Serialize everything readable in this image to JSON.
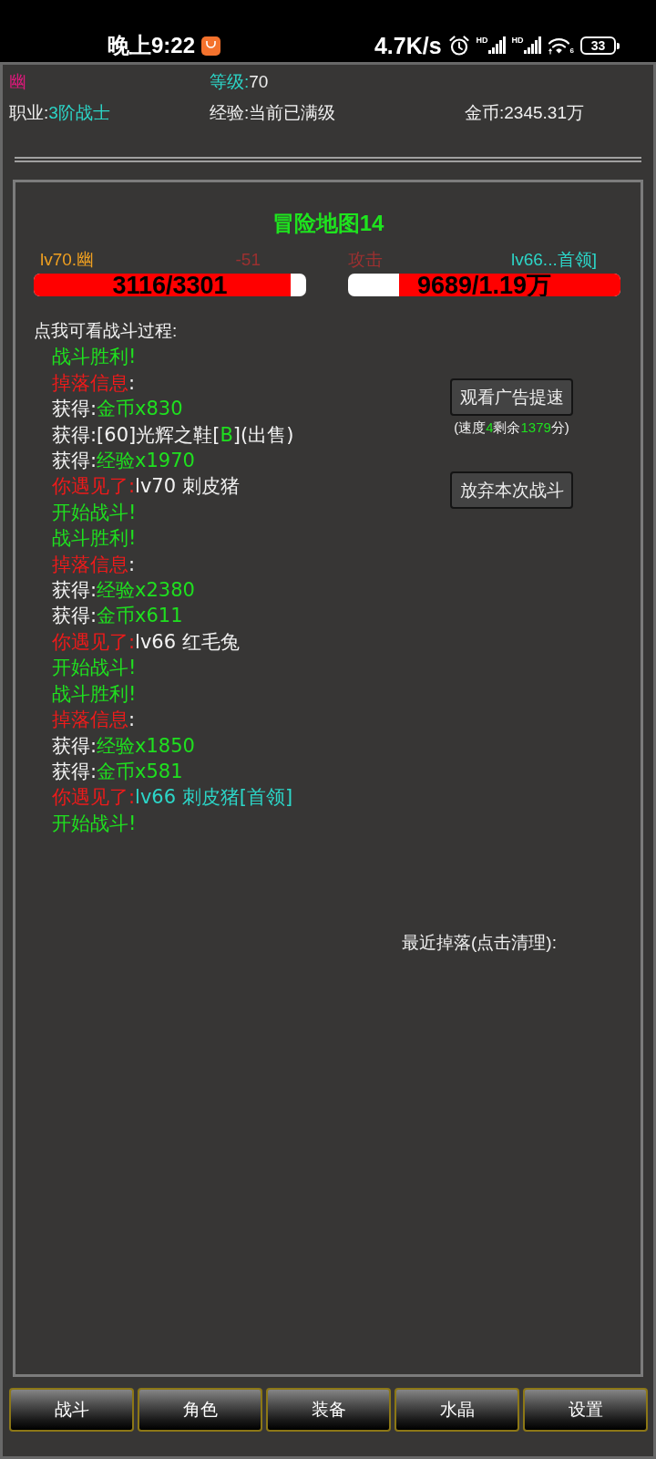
{
  "status_bar": {
    "time": "晚上9:22",
    "net_speed": "4.7K/s",
    "signals": [
      {
        "badge": "HD"
      },
      {
        "badge": "HD"
      }
    ],
    "wifi_badge": "6",
    "battery": "33"
  },
  "player": {
    "name": "幽",
    "level": {
      "label": "等级:",
      "value": "70"
    },
    "class": {
      "label": "职业:",
      "value": "3阶战士"
    },
    "exp": {
      "label": "经验:",
      "value": "当前已满级"
    },
    "gold": {
      "label": "金币:",
      "value": "2345.31万"
    }
  },
  "battle": {
    "title": "冒险地图14",
    "player": {
      "name": "lv70.幽",
      "damage": "-51",
      "hp": "3116/3301",
      "level": 0.944
    },
    "enemy": {
      "action": "攻击",
      "name": "lv66...首领]",
      "hp": "9689/1.19万",
      "level": 0.814
    }
  },
  "log": {
    "header": "点我可看战斗过程:",
    "lines": [
      {
        "segments": [
          {
            "text": "战斗胜利!",
            "kind": "good"
          }
        ]
      },
      {
        "segments": [
          {
            "text": "掉落信息",
            "kind": "alert"
          },
          {
            "text": ":",
            "kind": "plain"
          }
        ]
      },
      {
        "segments": [
          {
            "text": "获得:",
            "kind": "plain"
          },
          {
            "text": "金币x830",
            "kind": "good"
          }
        ]
      },
      {
        "segments": [
          {
            "text": "获得:[60]光辉之鞋[",
            "kind": "plain"
          },
          {
            "text": "B",
            "kind": "good"
          },
          {
            "text": "](出售)",
            "kind": "plain"
          }
        ]
      },
      {
        "segments": [
          {
            "text": "获得:",
            "kind": "plain"
          },
          {
            "text": "经验x1970",
            "kind": "good"
          }
        ]
      },
      {
        "segments": [
          {
            "text": "你遇见了:",
            "kind": "alert"
          },
          {
            "text": "lv70 刺皮猪",
            "kind": "plain"
          }
        ]
      },
      {
        "segments": [
          {
            "text": "开始战斗!",
            "kind": "good"
          }
        ]
      },
      {
        "segments": [
          {
            "text": "战斗胜利!",
            "kind": "good"
          }
        ]
      },
      {
        "segments": [
          {
            "text": "掉落信息",
            "kind": "alert"
          },
          {
            "text": ":",
            "kind": "plain"
          }
        ]
      },
      {
        "segments": [
          {
            "text": "获得:",
            "kind": "plain"
          },
          {
            "text": "经验x2380",
            "kind": "good"
          }
        ]
      },
      {
        "segments": [
          {
            "text": "获得:",
            "kind": "plain"
          },
          {
            "text": "金币x611",
            "kind": "good"
          }
        ]
      },
      {
        "segments": [
          {
            "text": "你遇见了:",
            "kind": "alert"
          },
          {
            "text": "lv66 红毛兔",
            "kind": "plain"
          }
        ]
      },
      {
        "segments": [
          {
            "text": "开始战斗!",
            "kind": "good"
          }
        ]
      },
      {
        "segments": [
          {
            "text": "战斗胜利!",
            "kind": "good"
          }
        ]
      },
      {
        "segments": [
          {
            "text": "掉落信息",
            "kind": "alert"
          },
          {
            "text": ":",
            "kind": "plain"
          }
        ]
      },
      {
        "segments": [
          {
            "text": "获得:",
            "kind": "plain"
          },
          {
            "text": "经验x1850",
            "kind": "good"
          }
        ]
      },
      {
        "segments": [
          {
            "text": "获得:",
            "kind": "plain"
          },
          {
            "text": "金币x581",
            "kind": "good"
          }
        ]
      },
      {
        "segments": [
          {
            "text": "你遇见了:",
            "kind": "alert"
          },
          {
            "text": "lv66 刺皮猪[首领]",
            "kind": "rare"
          }
        ]
      },
      {
        "segments": [
          {
            "text": "开始战斗!",
            "kind": "good"
          }
        ]
      }
    ]
  },
  "actions": {
    "watch_ad": "观看广告提速",
    "speed_note": [
      {
        "text": "(速度",
        "kind": "plain"
      },
      {
        "text": "4",
        "kind": "good"
      },
      {
        "text": "剩余",
        "kind": "plain"
      },
      {
        "text": "1379",
        "kind": "good"
      },
      {
        "text": "分)",
        "kind": "plain"
      }
    ],
    "quit": "放弃本次战斗"
  },
  "recent_drops": {
    "label": "最近掉落(点击清理):"
  },
  "tabs": [
    {
      "label": "战斗"
    },
    {
      "label": "角色"
    },
    {
      "label": "装备"
    },
    {
      "label": "水晶"
    },
    {
      "label": "设置"
    }
  ]
}
